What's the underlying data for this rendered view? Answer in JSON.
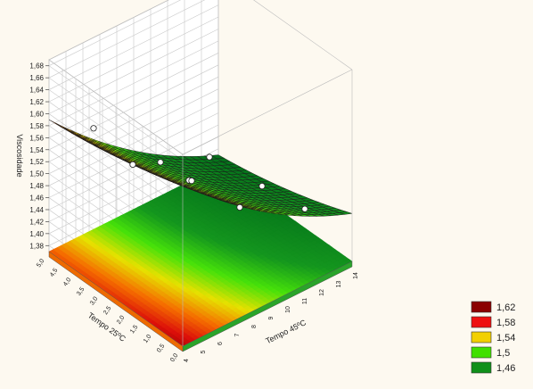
{
  "chart_data": {
    "type": "surface3d",
    "title": "",
    "x_axis": {
      "label": "Tempo 45ºC",
      "ticks": [
        "4",
        "5",
        "6",
        "7",
        "8",
        "9",
        "10",
        "11",
        "12",
        "13",
        "14"
      ],
      "range": [
        4,
        14
      ]
    },
    "y_axis": {
      "label": "Tempo 25ºC",
      "ticks": [
        "0,0",
        "0,5",
        "1,0",
        "1,5",
        "2,0",
        "2,5",
        "3,0",
        "3,5",
        "4,0",
        "4,5",
        "5,0"
      ],
      "range": [
        0,
        5
      ]
    },
    "z_axis": {
      "label": "Viscosidade",
      "ticks": [
        "1,38",
        "1,40",
        "1,42",
        "1,44",
        "1,46",
        "1,48",
        "1,50",
        "1,52",
        "1,54",
        "1,56",
        "1,58",
        "1,60",
        "1,62",
        "1,64",
        "1,66",
        "1,68"
      ],
      "range": [
        1.37,
        1.69
      ]
    },
    "surface_corners": {
      "x4_y0": 1.64,
      "x4_y5": 1.59,
      "x14_y0": 1.45,
      "x14_y5": 1.39
    },
    "observed_points": [
      {
        "x": 5,
        "y": 0.4,
        "z": 1.62
      },
      {
        "x": 9,
        "y": 0.2,
        "z": 1.56
      },
      {
        "x": 12,
        "y": 0.5,
        "z": 1.47
      },
      {
        "x": 5,
        "y": 2.5,
        "z": 1.58
      },
      {
        "x": 8,
        "y": 2.2,
        "z": 1.52
      },
      {
        "x": 11,
        "y": 2.3,
        "z": 1.43
      },
      {
        "x": 6,
        "y": 4.6,
        "z": 1.56
      },
      {
        "x": 9,
        "y": 4.0,
        "z": 1.48
      },
      {
        "x": 13,
        "y": 4.7,
        "z": 1.41
      }
    ],
    "legend": {
      "placement": "bottom-right",
      "entries": [
        {
          "label": "1,62",
          "color": "#8b0000"
        },
        {
          "label": "1,58",
          "color": "#ee1010"
        },
        {
          "label": "1,54",
          "color": "#f2d000"
        },
        {
          "label": "1,5",
          "color": "#40e000"
        },
        {
          "label": "1,46",
          "color": "#10901a"
        }
      ]
    },
    "grid": true
  }
}
